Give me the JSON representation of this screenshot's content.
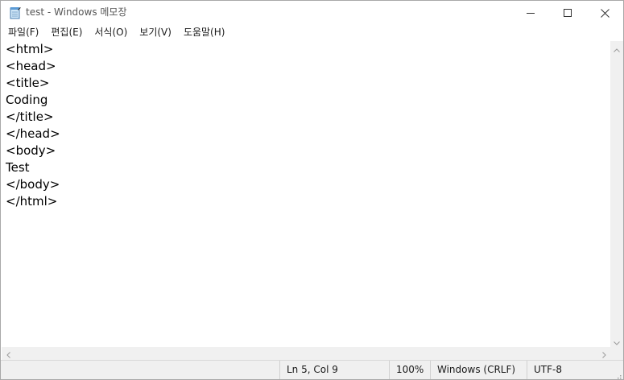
{
  "window": {
    "title": "test - Windows 메모장"
  },
  "menu": {
    "items": [
      {
        "id": "file",
        "label": "파일(F)"
      },
      {
        "id": "edit",
        "label": "편집(E)"
      },
      {
        "id": "format",
        "label": "서식(O)"
      },
      {
        "id": "view",
        "label": "보기(V)"
      },
      {
        "id": "help",
        "label": "도움말(H)"
      }
    ]
  },
  "editor": {
    "lines": [
      "<html>",
      "<head>",
      "<title>",
      "Coding",
      "</title>",
      "</head>",
      "<body>",
      "Test",
      "</body>",
      "</html>"
    ]
  },
  "status": {
    "position": "Ln 5, Col 9",
    "zoom": "100%",
    "line_ending": "Windows (CRLF)",
    "encoding": "UTF-8"
  },
  "icons": {
    "app": "notepad-icon",
    "minimize": "minimize-icon",
    "maximize": "maximize-icon",
    "close": "close-icon"
  },
  "colors": {
    "chrome": "#f0f0f0",
    "text": "#000000",
    "title_text": "#555555"
  }
}
